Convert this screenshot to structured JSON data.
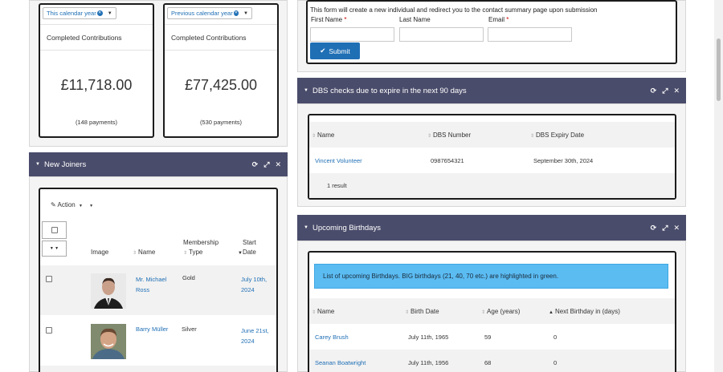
{
  "contrib_this_year": {
    "filter": "This calendar year",
    "label": "Completed Contributions",
    "amount": "£11,718.00",
    "payments": "(148 payments)"
  },
  "contrib_prev_year": {
    "filter": "Previous calendar year",
    "label": "Completed Contributions",
    "amount": "£77,425.00",
    "payments": "(530 payments)"
  },
  "new_joiners": {
    "title": "New Joiners",
    "action_label": "Action",
    "columns": [
      "Image",
      "Name",
      "Membership Type",
      "Start Date"
    ],
    "col_membership_l1": "Membership",
    "col_membership_l2": "Type",
    "col_start_l1": "Start",
    "col_start_l2": "Date",
    "rows": [
      {
        "name_l1": "Mr. Michael",
        "name_l2": "Ross",
        "membership": "Gold",
        "date_l1": "July 10th,",
        "date_l2": "2024"
      },
      {
        "name_l1": "Barry Müller",
        "name_l2": "",
        "membership": "Silver",
        "date_l1": "June 21st,",
        "date_l2": "2024"
      }
    ]
  },
  "form": {
    "notice": "This form will create a new individual and redirect you to the contact summary page upon submission",
    "first_name": "First Name",
    "last_name": "Last Name",
    "email": "Email",
    "required": "*",
    "submit": "Submit"
  },
  "dbs": {
    "title": "DBS checks due to expire in the next 90 days",
    "columns": [
      "Name",
      "DBS Number",
      "DBS Expiry Date"
    ],
    "rows": [
      {
        "name": "Vincent Volunteer",
        "number": "0987654321",
        "expiry": "September 30th, 2024"
      }
    ],
    "result_count": "1 result"
  },
  "birthdays": {
    "title": "Upcoming Birthdays",
    "info": "List of upcoming Birthdays. BIG birthdays (21, 40, 70 etc.) are highlighted in green.",
    "columns": [
      "Name",
      "Birth Date",
      "Age (years)",
      "Next Birthday in (days)"
    ],
    "rows": [
      {
        "name": "Carey Brush",
        "birth": "July 11th, 1965",
        "age": "59",
        "next": "0"
      },
      {
        "name": "Seanan Boatwright",
        "birth": "July 11th, 1956",
        "age": "68",
        "next": "0"
      }
    ]
  },
  "colors": {
    "header_bg": "#4a4c6b",
    "link": "#1f6fb5",
    "info_bg": "#5bbcf2"
  },
  "icons": [
    "refresh-icon",
    "expand-icon",
    "close-icon",
    "pencil-icon",
    "check-icon",
    "sort-icon"
  ]
}
